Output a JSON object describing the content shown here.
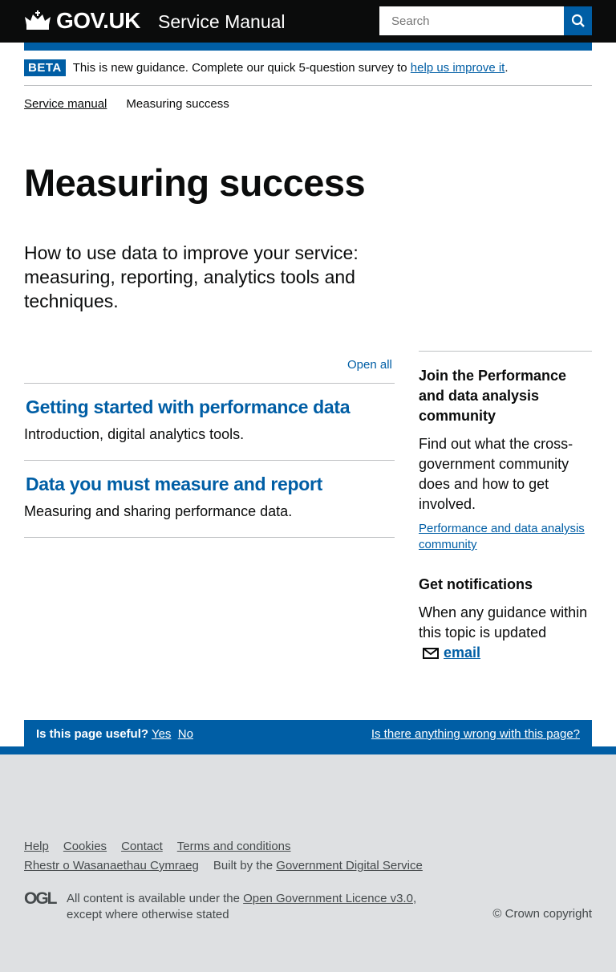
{
  "header": {
    "logo": "GOV.UK",
    "service": "Service Manual",
    "search_placeholder": "Search"
  },
  "beta": {
    "tag": "BETA",
    "text": "This is new guidance. Complete our quick 5-question survey to ",
    "link": "help us improve it",
    "end": "."
  },
  "breadcrumb": [
    {
      "label": "Service manual"
    },
    {
      "label": "Measuring success"
    }
  ],
  "title": "Measuring success",
  "lead": "How to use data to improve your service: measuring, reporting, analytics tools and techniques.",
  "open_all": "Open all",
  "sections": [
    {
      "title": "Getting started with performance data",
      "desc": "Introduction, digital analytics tools."
    },
    {
      "title": "Data you must measure and report",
      "desc": "Measuring and sharing performance data."
    }
  ],
  "sidebar": {
    "community_title": "Join the Performance and data analysis community",
    "community_text": "Find out what the cross-government community does and how to get involved.",
    "community_link": "Performance and data analysis community",
    "notif_title": "Get notifications",
    "notif_text": "When any guidance within this topic is updated",
    "email": "email"
  },
  "feedback": {
    "question": "Is this page useful?",
    "yes": "Yes",
    "no": "No",
    "wrong": "Is there anything wrong with this page?"
  },
  "footer": {
    "links": [
      "Help",
      "Cookies",
      "Contact",
      "Terms and conditions"
    ],
    "welsh": "Rhestr o Wasanaethau Cymraeg",
    "built": "Built by the ",
    "gds": "Government Digital Service",
    "ogl": "OGL",
    "licence_pre": "All content is available under the ",
    "licence": "Open Government Licence v3.0",
    "licence_post": ",",
    "licence_line2": "except where otherwise stated",
    "copyright": "© Crown copyright"
  }
}
